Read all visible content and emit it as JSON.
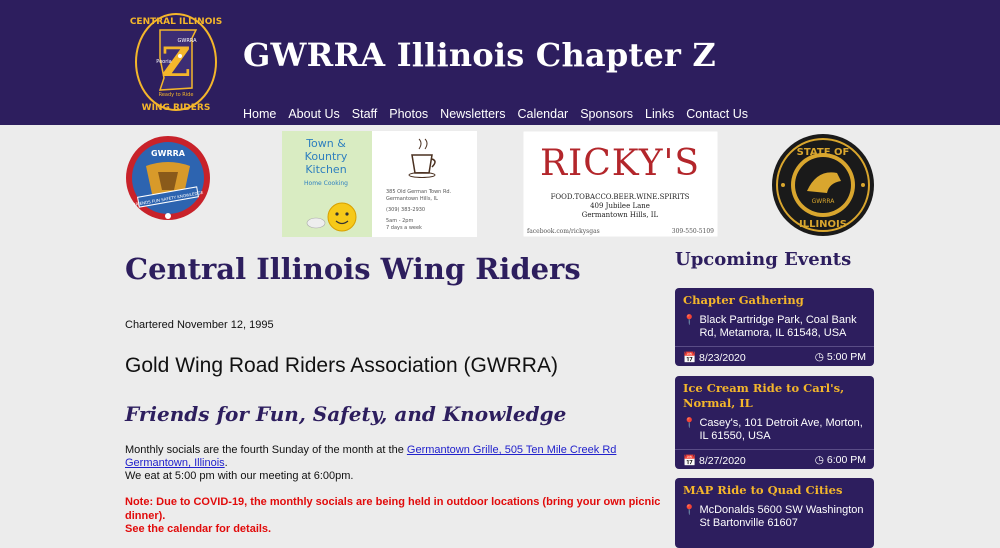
{
  "header": {
    "logo_text_top": "CENTRAL ILLINOIS",
    "logo_text_bottom": "WING RIDERS",
    "logo_z": "Z",
    "logo_small": "GWRRA",
    "logo_city": "Peoria",
    "logo_tag": "Ready to Ride",
    "title": "GWRRA Illinois Chapter Z",
    "nav": [
      "Home",
      "About Us",
      "Staff",
      "Photos",
      "Newsletters",
      "Calendar",
      "Sponsors",
      "Links",
      "Contact Us"
    ]
  },
  "banners": {
    "gwrra_badge": {
      "top": "GWRRA",
      "ribbon": "FRIENDS FUN SAFETY KNOWLEDGE"
    },
    "town_kountry": {
      "title_lines": [
        "Town &",
        "Kountry",
        "Kitchen"
      ],
      "subtitle": "Home Cooking",
      "address": [
        "385 Old German Town Rd.",
        "Germantown Hills, IL"
      ],
      "phone": "(309) 383-2930",
      "hours": [
        "5am - 2pm",
        "7 days a week"
      ]
    },
    "rickys": {
      "name": "RICKY'S",
      "tagline": "FOOD.TOBACCO.BEER.WINE.SPIRITS",
      "address": [
        "409 Jubilee Lane",
        "Germantown Hills, IL"
      ],
      "facebook": "facebook.com/rickysgas",
      "phone": "309-550-5109"
    },
    "state_badge": {
      "top": "STATE OF",
      "bottom": "ILLINOIS",
      "center": "GWRRA"
    }
  },
  "main": {
    "title": "Central Illinois Wing Riders",
    "chartered": "Chartered November 12, 1995",
    "association": "Gold Wing Road Riders Association (GWRRA)",
    "slogan": "Friends for Fun, Safety, and Knowledge",
    "socials_prefix": "Monthly socials are the fourth Sunday of the month at the ",
    "socials_link": "Germantown Grille, 505 Ten Mile Creek Rd Germantown, Illinois",
    "socials_suffix": ".",
    "meeting": "We eat at 5:00 pm with our meeting at 6:00pm.",
    "note_line1": "Note:  Due to COVID-19, the monthly socials are being held in outdoor locations (bring your own picnic dinner).",
    "note_line2": "See the calendar for details."
  },
  "sidebar": {
    "title": "Upcoming Events",
    "events": [
      {
        "title": "Chapter Gathering",
        "location": "Black Partridge Park, Coal Bank Rd, Metamora, IL 61548, USA",
        "date": "8/23/2020",
        "time": "5:00 PM"
      },
      {
        "title": "Ice Cream Ride to Carl's, Normal, IL",
        "location": "Casey's, 101 Detroit Ave, Morton, IL 61550, USA",
        "date": "8/27/2020",
        "time": "6:00 PM"
      },
      {
        "title": "MAP Ride to Quad Cities",
        "location": "McDonalds 5600 SW Washington St Bartonville 61607",
        "date": "",
        "time": ""
      }
    ]
  },
  "colors": {
    "header_bg": "#2d1e5e",
    "accent_gold": "#f4b62b",
    "note_red": "#e10b0b",
    "link": "#2222cc"
  },
  "icons": {
    "location": "map-pin-icon",
    "date": "calendar-icon",
    "time": "clock-icon"
  }
}
